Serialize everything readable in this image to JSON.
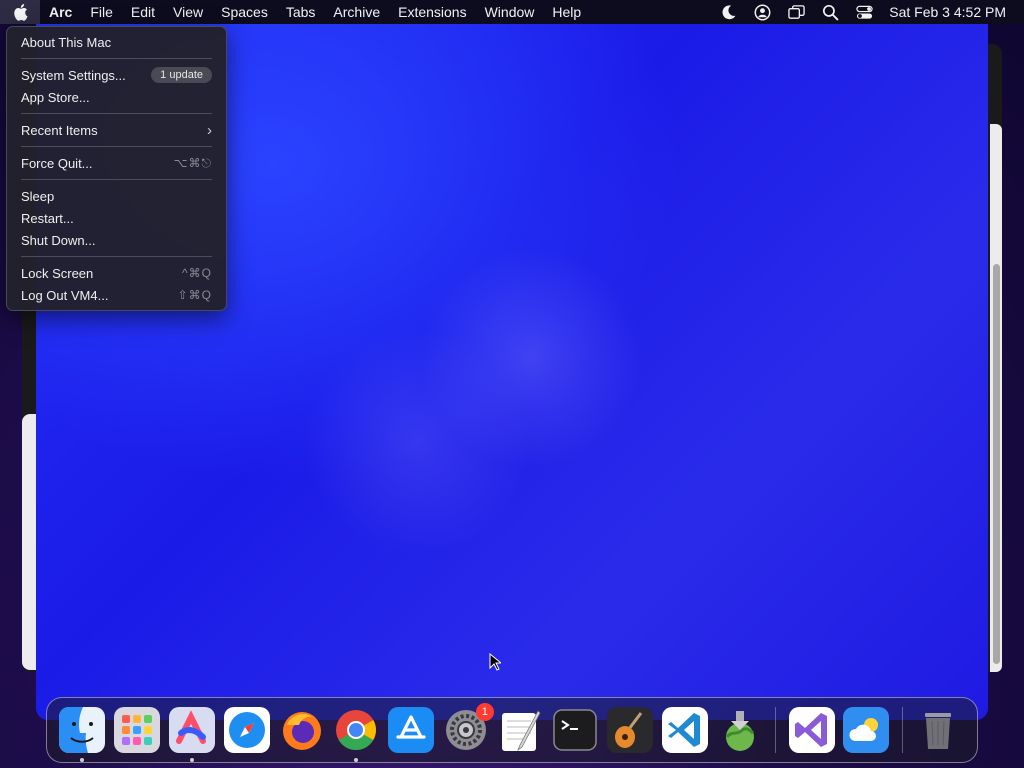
{
  "menubar": {
    "app_name": "Arc",
    "items": [
      "File",
      "Edit",
      "View",
      "Spaces",
      "Tabs",
      "Archive",
      "Extensions",
      "Window",
      "Help"
    ],
    "status_icons": [
      "moon-icon",
      "user-circle-icon",
      "screen-mirroring-icon",
      "search-icon",
      "control-center-icon"
    ],
    "clock": "Sat Feb 3  4:52 PM"
  },
  "apple_menu": {
    "about": "About This Mac",
    "system_settings": "System Settings...",
    "update_badge": "1 update",
    "app_store": "App Store...",
    "recent_items": "Recent Items",
    "force_quit": "Force Quit...",
    "force_quit_shortcut": "⌥⌘⎋",
    "sleep": "Sleep",
    "restart": "Restart...",
    "shut_down": "Shut Down...",
    "lock_screen": "Lock Screen",
    "lock_screen_shortcut": "^⌘Q",
    "log_out": "Log Out VM4...",
    "log_out_shortcut": "⇧⌘Q"
  },
  "dock": {
    "apps": [
      "finder-icon",
      "launchpad-icon",
      "arc-icon",
      "safari-icon",
      "firefox-icon",
      "chrome-icon",
      "app-store-icon",
      "system-settings-icon",
      "textedit-icon",
      "terminal-icon",
      "garageband-icon",
      "vscode-icon",
      "installer-icon",
      "visual-studio-icon",
      "weather-icon",
      "trash-icon"
    ],
    "system_settings_badge": "1"
  }
}
